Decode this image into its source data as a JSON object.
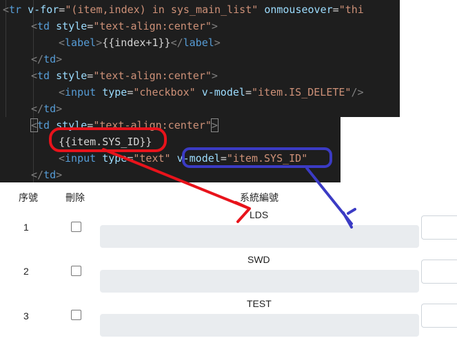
{
  "code": {
    "line1": {
      "lt": "<",
      "tag": "tr",
      "attr1": "v-for",
      "eq1": "=",
      "str1": "\"(item,index) in sys_main_list\"",
      "attr2": "onmouseover",
      "eq2": "=",
      "str2": "\"thi"
    },
    "line2": {
      "lt": "<",
      "tag": "td",
      "attr": "style",
      "eq": "=",
      "str": "\"text-align:center\"",
      "gt": ">"
    },
    "line3": {
      "lt": "<",
      "tag": "label",
      "gt": ">",
      "text": "{{index+1}}",
      "close": "</",
      "ctag": "label",
      "cgt": ">"
    },
    "line4": {
      "close": "</",
      "tag": "td",
      "gt": ">"
    },
    "line5": {
      "lt": "<",
      "tag": "td",
      "attr": "style",
      "eq": "=",
      "str": "\"text-align:center\"",
      "gt": ">"
    },
    "line6": {
      "lt": "<",
      "tag": "input",
      "attr1": "type",
      "eq1": "=",
      "str1": "\"checkbox\"",
      "attr2": "v-model",
      "eq2": "=",
      "str2": "\"item.IS_DELETE\"",
      "end": "/>"
    },
    "line7": {
      "close": "</",
      "tag": "td",
      "gt": ">"
    },
    "line8": {
      "lt": "<",
      "tag": "td",
      "attr": "style",
      "eq": "=",
      "str": "\"text-align:center\"",
      "gt": ">"
    },
    "line9": {
      "text": "{{item.SYS_ID}}"
    },
    "line10": {
      "lt": "<",
      "tag": "input",
      "attr1": "type",
      "eq1": "=",
      "str1": "\"text\"",
      "attr2": "v-model",
      "eq2": "=",
      "str2": "\"item.SYS_ID\""
    },
    "line11": {
      "close": "</",
      "tag": "td",
      "gt": ">"
    }
  },
  "table": {
    "headers": {
      "index": "序號",
      "delete": "刪除",
      "sysid": "系統編號"
    },
    "rows": [
      {
        "num": "1",
        "sysid": "LDS",
        "checked": false
      },
      {
        "num": "2",
        "sysid": "SWD",
        "checked": false
      },
      {
        "num": "3",
        "sysid": "TEST",
        "checked": false
      }
    ]
  },
  "annotations": {
    "red_color": "#e8131b",
    "blue_color": "#3b3bc4"
  }
}
